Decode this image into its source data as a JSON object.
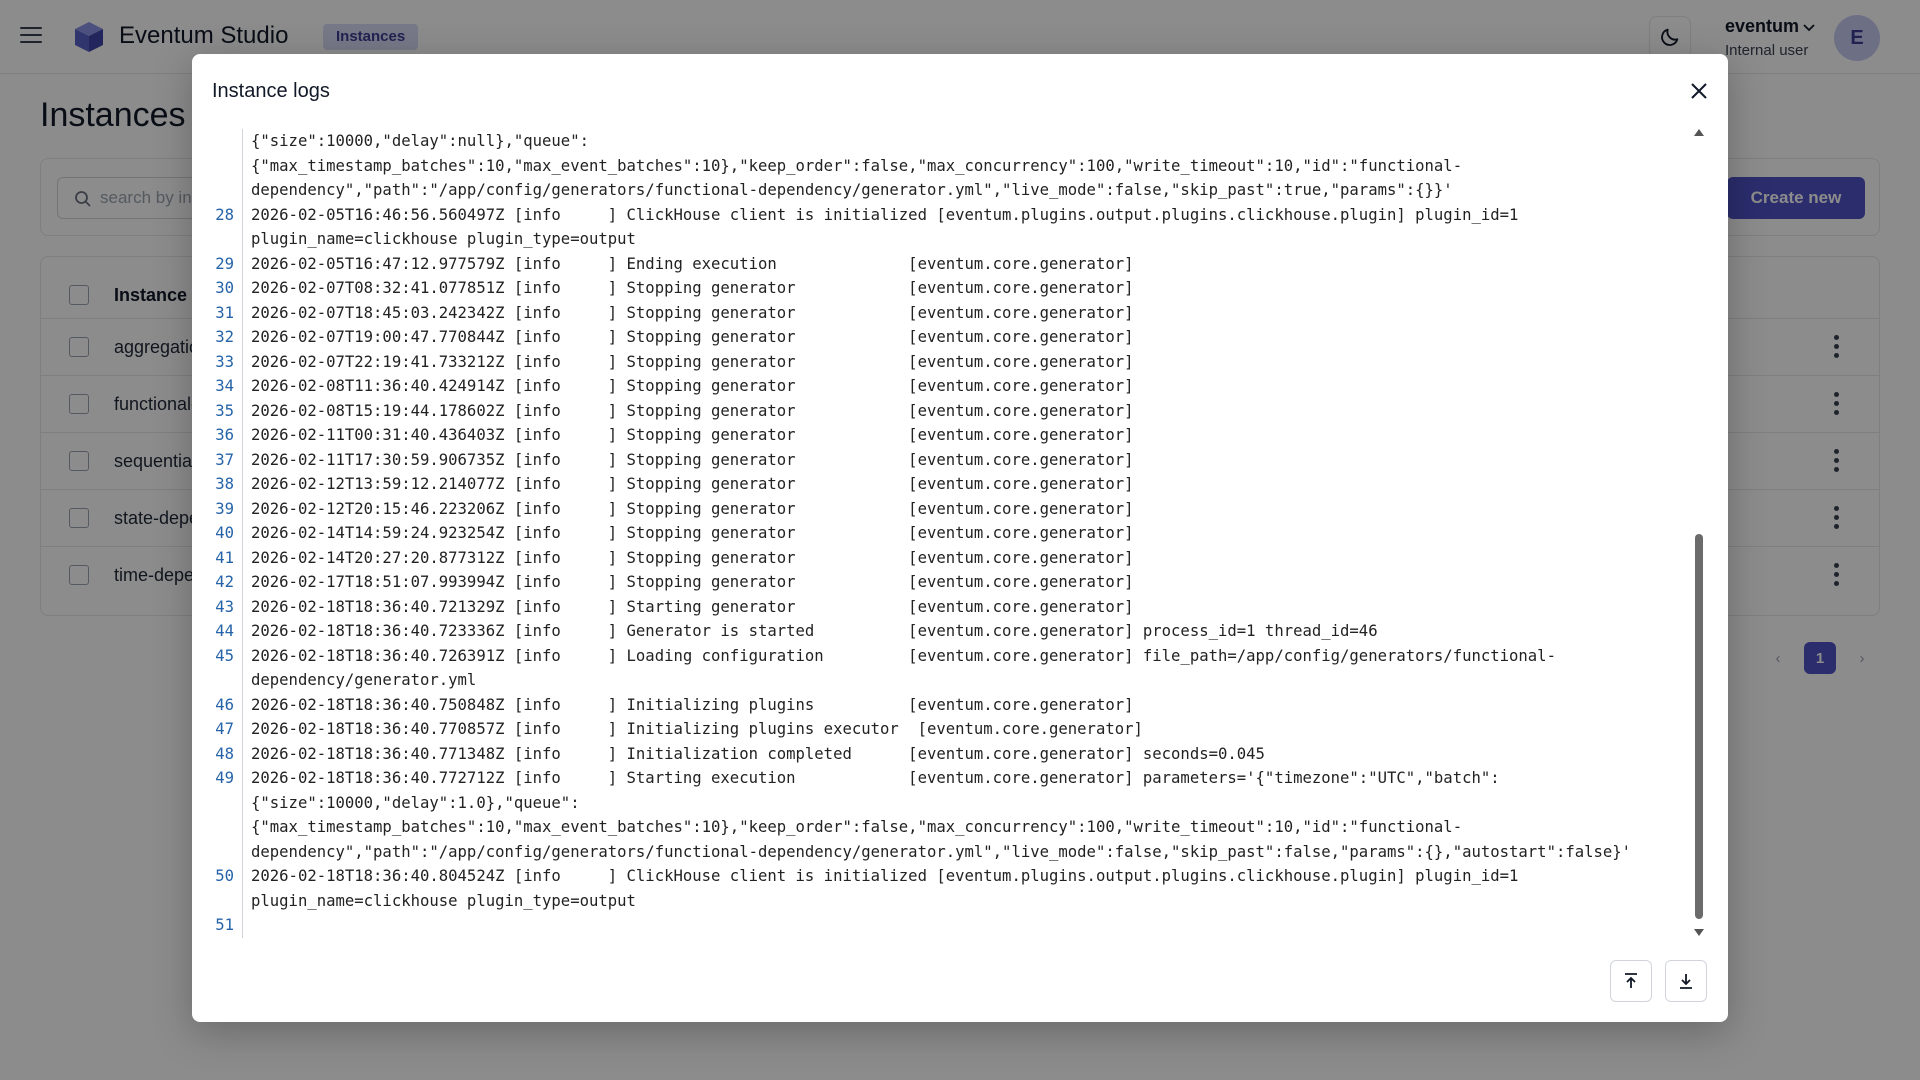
{
  "app": {
    "title": "Eventum Studio",
    "breadcrumb": "Instances",
    "user": {
      "name": "eventum",
      "role": "Internal user",
      "avatar_initial": "E"
    }
  },
  "page": {
    "title": "Instances",
    "search_placeholder": "search by instance",
    "create_label": "Create new"
  },
  "table": {
    "header": "Instance",
    "rows": [
      {
        "name": "aggregation"
      },
      {
        "name": "functional-"
      },
      {
        "name": "sequential"
      },
      {
        "name": "state-depe"
      },
      {
        "name": "time-depe"
      }
    ]
  },
  "pagination": {
    "prev": "‹",
    "current": "1",
    "next": "›"
  },
  "modal": {
    "title": "Instance logs",
    "lines": [
      {
        "n": "",
        "text": "{\"size\":10000,\"delay\":null},\"queue\":"
      },
      {
        "n": "",
        "text": "{\"max_timestamp_batches\":10,\"max_event_batches\":10},\"keep_order\":false,\"max_concurrency\":100,\"write_timeout\":10,\"id\":\"functional-"
      },
      {
        "n": "",
        "text": "dependency\",\"path\":\"/app/config/generators/functional-dependency/generator.yml\",\"live_mode\":false,\"skip_past\":true,\"params\":{}}'"
      },
      {
        "n": "28",
        "text": "2026-02-05T16:46:56.560497Z [info     ] ClickHouse client is initialized [eventum.plugins.output.plugins.clickhouse.plugin] plugin_id=1\nplugin_name=clickhouse plugin_type=output"
      },
      {
        "n": "29",
        "text": "2026-02-05T16:47:12.977579Z [info     ] Ending execution              [eventum.core.generator]"
      },
      {
        "n": "30",
        "text": "2026-02-07T08:32:41.077851Z [info     ] Stopping generator            [eventum.core.generator]"
      },
      {
        "n": "31",
        "text": "2026-02-07T18:45:03.242342Z [info     ] Stopping generator            [eventum.core.generator]"
      },
      {
        "n": "32",
        "text": "2026-02-07T19:00:47.770844Z [info     ] Stopping generator            [eventum.core.generator]"
      },
      {
        "n": "33",
        "text": "2026-02-07T22:19:41.733212Z [info     ] Stopping generator            [eventum.core.generator]"
      },
      {
        "n": "34",
        "text": "2026-02-08T11:36:40.424914Z [info     ] Stopping generator            [eventum.core.generator]"
      },
      {
        "n": "35",
        "text": "2026-02-08T15:19:44.178602Z [info     ] Stopping generator            [eventum.core.generator]"
      },
      {
        "n": "36",
        "text": "2026-02-11T00:31:40.436403Z [info     ] Stopping generator            [eventum.core.generator]"
      },
      {
        "n": "37",
        "text": "2026-02-11T17:30:59.906735Z [info     ] Stopping generator            [eventum.core.generator]"
      },
      {
        "n": "38",
        "text": "2026-02-12T13:59:12.214077Z [info     ] Stopping generator            [eventum.core.generator]"
      },
      {
        "n": "39",
        "text": "2026-02-12T20:15:46.223206Z [info     ] Stopping generator            [eventum.core.generator]"
      },
      {
        "n": "40",
        "text": "2026-02-14T14:59:24.923254Z [info     ] Stopping generator            [eventum.core.generator]"
      },
      {
        "n": "41",
        "text": "2026-02-14T20:27:20.877312Z [info     ] Stopping generator            [eventum.core.generator]"
      },
      {
        "n": "42",
        "text": "2026-02-17T18:51:07.993994Z [info     ] Stopping generator            [eventum.core.generator]"
      },
      {
        "n": "43",
        "text": "2026-02-18T18:36:40.721329Z [info     ] Starting generator            [eventum.core.generator]"
      },
      {
        "n": "44",
        "text": "2026-02-18T18:36:40.723336Z [info     ] Generator is started          [eventum.core.generator] process_id=1 thread_id=46"
      },
      {
        "n": "45",
        "text": "2026-02-18T18:36:40.726391Z [info     ] Loading configuration         [eventum.core.generator] file_path=/app/config/generators/functional-\ndependency/generator.yml"
      },
      {
        "n": "46",
        "text": "2026-02-18T18:36:40.750848Z [info     ] Initializing plugins          [eventum.core.generator]"
      },
      {
        "n": "47",
        "text": "2026-02-18T18:36:40.770857Z [info     ] Initializing plugins executor  [eventum.core.generator]"
      },
      {
        "n": "48",
        "text": "2026-02-18T18:36:40.771348Z [info     ] Initialization completed      [eventum.core.generator] seconds=0.045"
      },
      {
        "n": "49",
        "text": "2026-02-18T18:36:40.772712Z [info     ] Starting execution            [eventum.core.generator] parameters='{\"timezone\":\"UTC\",\"batch\":\n{\"size\":10000,\"delay\":1.0},\"queue\":\n{\"max_timestamp_batches\":10,\"max_event_batches\":10},\"keep_order\":false,\"max_concurrency\":100,\"write_timeout\":10,\"id\":\"functional-\ndependency\",\"path\":\"/app/config/generators/functional-dependency/generator.yml\",\"live_mode\":false,\"skip_past\":false,\"params\":{},\"autostart\":false}'"
      },
      {
        "n": "50",
        "text": "2026-02-18T18:36:40.804524Z [info     ] ClickHouse client is initialized [eventum.plugins.output.plugins.clickhouse.plugin] plugin_id=1\nplugin_name=clickhouse plugin_type=output"
      },
      {
        "n": "51",
        "text": ""
      }
    ]
  }
}
